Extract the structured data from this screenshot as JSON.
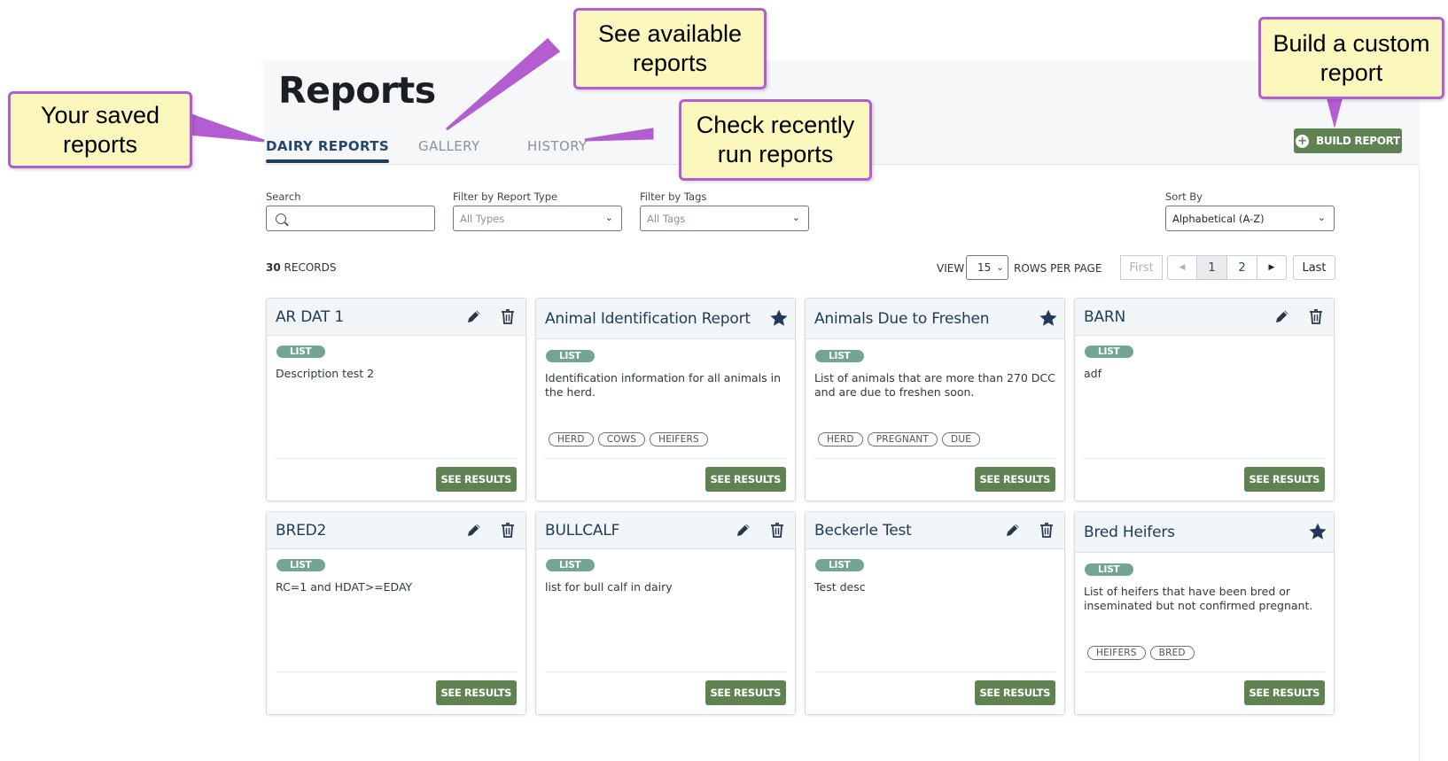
{
  "page": {
    "title": "Reports",
    "tabs": [
      {
        "label": "DAIRY REPORTS",
        "active": true
      },
      {
        "label": "GALLERY",
        "active": false
      },
      {
        "label": "HISTORY",
        "active": false
      }
    ],
    "build_button": "BUILD REPORT"
  },
  "filters": {
    "search_label": "Search",
    "type_label": "Filter by Report Type",
    "type_value": "All Types",
    "tags_label": "Filter by Tags",
    "tags_value": "All Tags",
    "sort_label": "Sort By",
    "sort_value": "Alphabetical (A-Z)"
  },
  "records": {
    "count": "30",
    "label": "RECORDS",
    "view_label": "VIEW",
    "rows_per_page": "15",
    "rows_label": "ROWS PER PAGE"
  },
  "pagination": {
    "first": "First",
    "prev": "◀",
    "pages": [
      "1",
      "2"
    ],
    "current": "1",
    "next": "▶",
    "last": "Last"
  },
  "cards": [
    {
      "title": "AR DAT 1",
      "badge": "LIST",
      "desc": "Description test 2",
      "tags": [],
      "starred": false,
      "editable": true,
      "button": "SEE RESULTS"
    },
    {
      "title": "Animal Identification Report",
      "badge": "LIST",
      "desc": "Identification information for all animals in the herd.",
      "tags": [
        "HERD",
        "COWS",
        "HEIFERS"
      ],
      "starred": true,
      "editable": false,
      "button": "SEE RESULTS"
    },
    {
      "title": "Animals Due to Freshen",
      "badge": "LIST",
      "desc": "List of animals that are more than 270 DCC and are due to freshen soon.",
      "tags": [
        "HERD",
        "PREGNANT",
        "DUE"
      ],
      "starred": true,
      "editable": false,
      "button": "SEE RESULTS"
    },
    {
      "title": "BARN",
      "badge": "LIST",
      "desc": "adf",
      "tags": [],
      "starred": false,
      "editable": true,
      "button": "SEE RESULTS"
    },
    {
      "title": "BRED2",
      "badge": "LIST",
      "desc": "RC=1 and HDAT>=EDAY",
      "tags": [],
      "starred": false,
      "editable": true,
      "button": "SEE RESULTS"
    },
    {
      "title": "BULLCALF",
      "badge": "LIST",
      "desc": "list for bull calf in dairy",
      "tags": [],
      "starred": false,
      "editable": true,
      "button": "SEE RESULTS"
    },
    {
      "title": "Beckerle Test",
      "badge": "LIST",
      "desc": "Test desc",
      "tags": [],
      "starred": false,
      "editable": true,
      "button": "SEE RESULTS"
    },
    {
      "title": "Bred Heifers",
      "badge": "LIST",
      "desc": "List of heifers that have been bred or inseminated but not confirmed pregnant.",
      "tags": [
        "HEIFERS",
        "BRED"
      ],
      "starred": true,
      "editable": false,
      "button": "SEE RESULTS"
    }
  ],
  "callouts": {
    "saved": "Your saved reports",
    "gallery": "See available reports",
    "history": "Check recently run reports",
    "build": "Build a custom report"
  },
  "colors": {
    "accent_green": "#5e8252",
    "badge_teal": "#72a592",
    "navy": "#1e3a57",
    "callout_fill": "#fcf7bd",
    "callout_border": "#b35dd0"
  }
}
